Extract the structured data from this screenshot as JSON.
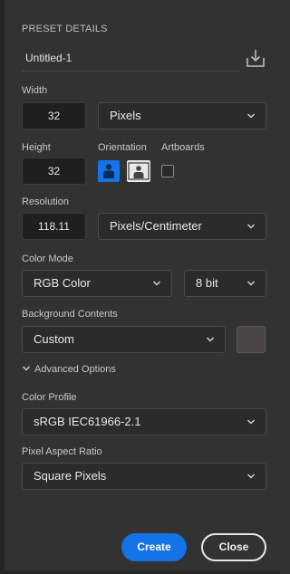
{
  "preset": {
    "section_title": "PRESET DETAILS",
    "name": "Untitled-1"
  },
  "width": {
    "label": "Width",
    "value": "32",
    "unit": "Pixels"
  },
  "height": {
    "label": "Height",
    "value": "32"
  },
  "orientation": {
    "label": "Orientation",
    "selected": "portrait"
  },
  "artboards": {
    "label": "Artboards",
    "checked": false
  },
  "resolution": {
    "label": "Resolution",
    "value": "118.11",
    "unit": "Pixels/Centimeter"
  },
  "color_mode": {
    "label": "Color Mode",
    "mode": "RGB Color",
    "depth": "8 bit"
  },
  "background": {
    "label": "Background Contents",
    "value": "Custom",
    "swatch_color": "#4a4646"
  },
  "advanced": {
    "label": "Advanced Options"
  },
  "color_profile": {
    "label": "Color Profile",
    "value": "sRGB IEC61966-2.1"
  },
  "pixel_aspect": {
    "label": "Pixel Aspect Ratio",
    "value": "Square Pixels"
  },
  "actions": {
    "create_label": "Create",
    "close_label": "Close"
  },
  "colors": {
    "accent": "#1473e6",
    "panel_bg": "#323232"
  }
}
